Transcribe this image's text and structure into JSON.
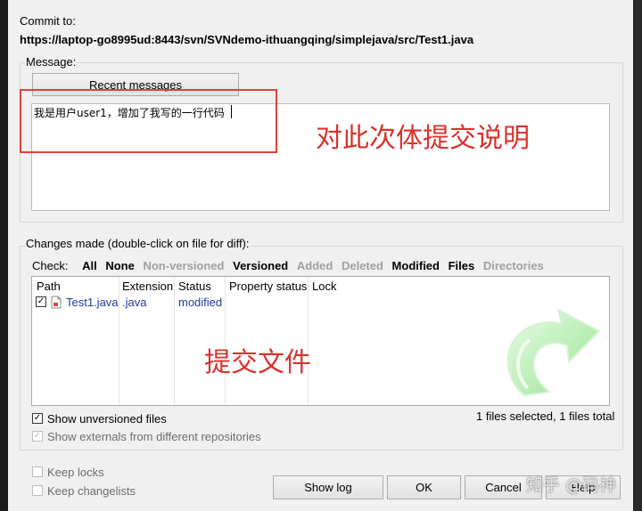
{
  "commit": {
    "label": "Commit to:",
    "url": "https://laptop-go8995ud:8443/svn/SVNdemo-ithuangqing/simplejava/src/Test1.java"
  },
  "message": {
    "group_label": "Message:",
    "recent_button": "Recent messages",
    "text": "我是用户user1，增加了我写的一行代码",
    "annotation": "对此次体提交说明"
  },
  "changes": {
    "group_label": "Changes made (double-click on file for diff):",
    "check_label": "Check:",
    "filters": [
      {
        "label": "All",
        "active": true
      },
      {
        "label": "None",
        "active": true
      },
      {
        "label": "Non-versioned",
        "active": false
      },
      {
        "label": "Versioned",
        "active": true
      },
      {
        "label": "Added",
        "active": false
      },
      {
        "label": "Deleted",
        "active": false
      },
      {
        "label": "Modified",
        "active": true
      },
      {
        "label": "Files",
        "active": true
      },
      {
        "label": "Directories",
        "active": false
      }
    ],
    "columns": [
      "Path",
      "Extension",
      "Status",
      "Property status",
      "Lock"
    ],
    "rows": [
      {
        "path": "Test1.java",
        "extension": ".java",
        "status": "modified",
        "property_status": "",
        "lock": ""
      }
    ],
    "annotation": "提交文件",
    "selection_info": "1 files selected, 1 files total"
  },
  "options": {
    "show_unversioned": "Show unversioned files",
    "show_externals": "Show externals from different repositories",
    "keep_locks": "Keep locks",
    "keep_changelists": "Keep changelists"
  },
  "buttons": {
    "show_log": "Show log",
    "ok": "OK",
    "cancel": "Cancel",
    "help": "Help"
  },
  "watermark": {
    "text": "知乎 @码神"
  }
}
